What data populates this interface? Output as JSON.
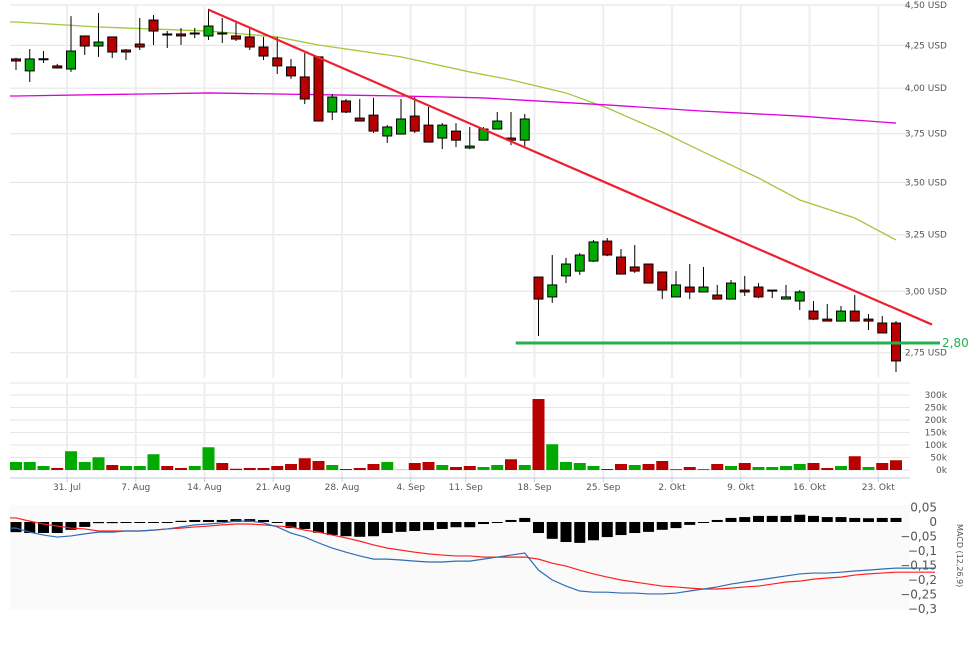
{
  "chart_data": [
    {
      "type": "candlestick",
      "panel": "price",
      "y_scale": "log",
      "ylim": [
        2.66,
        4.5
      ],
      "grid": true,
      "y_ticks": [
        {
          "value": 4.5,
          "label": "4,50 USD"
        },
        {
          "value": 4.25,
          "label": "4,25 USD"
        },
        {
          "value": 4.0,
          "label": "4,00 USD"
        },
        {
          "value": 3.75,
          "label": "3,75 USD"
        },
        {
          "value": 3.5,
          "label": "3,50 USD"
        },
        {
          "value": 3.25,
          "label": "3,25 USD"
        },
        {
          "value": 3.0,
          "label": "3,00 USD"
        },
        {
          "value": 2.75,
          "label": "2,75 USD"
        }
      ],
      "colors": {
        "up": "#00aa00",
        "down": "#b80000",
        "ma_long": "#dd00dd",
        "ma_short": "#a2c83c",
        "trendline": "#ee2030",
        "support": "#22b14c"
      },
      "dates": [
        "25. Jul",
        "26. Jul",
        "27. Jul",
        "28. Jul",
        "31. Jul",
        "1. Aug",
        "2. Aug",
        "3. Aug",
        "4. Aug",
        "7. Aug",
        "8. Aug",
        "9. Aug",
        "10. Aug",
        "11. Aug",
        "14. Aug",
        "15. Aug",
        "16. Aug",
        "17. Aug",
        "18. Aug",
        "21. Aug",
        "22. Aug",
        "23. Aug",
        "24. Aug",
        "25. Aug",
        "28. Aug",
        "29. Aug",
        "30. Aug",
        "31. Aug",
        "1. Sep",
        "5. Sep",
        "6. Sep",
        "7. Sep",
        "8. Sep",
        "11. Sep",
        "12. Sep",
        "13. Sep",
        "14. Sep",
        "15. Sep",
        "18. Sep",
        "19. Sep",
        "20. Sep",
        "21. Sep",
        "22. Sep",
        "25. Sep",
        "26. Sep",
        "27. Sep",
        "28. Sep",
        "29. Sep",
        "2. Okt",
        "3. Okt",
        "4. Okt",
        "5. Okt",
        "6. Okt",
        "9. Okt",
        "10. Okt",
        "11. Okt",
        "12. Okt",
        "13. Okt",
        "16. Okt",
        "17. Okt",
        "18. Okt",
        "19. Okt",
        "20. Okt",
        "23. Okt",
        "24. Okt"
      ],
      "ohlc": [
        [
          4.169,
          4.175,
          4.104,
          4.157
        ],
        [
          4.099,
          4.228,
          4.035,
          4.169
        ],
        [
          4.17,
          4.216,
          4.145,
          4.17
        ],
        [
          4.128,
          4.14,
          4.116,
          4.116
        ],
        [
          4.11,
          4.43,
          4.093,
          4.216
        ],
        [
          4.307,
          4.307,
          4.192,
          4.246
        ],
        [
          4.246,
          4.449,
          4.181,
          4.27
        ],
        [
          4.301,
          4.301,
          4.175,
          4.21
        ],
        [
          4.222,
          4.228,
          4.163,
          4.21
        ],
        [
          4.258,
          4.418,
          4.222,
          4.24
        ],
        [
          4.405,
          4.437,
          4.252,
          4.337
        ],
        [
          4.319,
          4.337,
          4.234,
          4.319
        ],
        [
          4.319,
          4.356,
          4.252,
          4.307
        ],
        [
          4.325,
          4.356,
          4.294,
          4.325
        ],
        [
          4.307,
          4.475,
          4.282,
          4.368
        ],
        [
          4.325,
          4.418,
          4.264,
          4.319
        ],
        [
          4.307,
          4.393,
          4.276,
          4.288
        ],
        [
          4.301,
          4.356,
          4.222,
          4.24
        ],
        [
          4.24,
          4.301,
          4.163,
          4.186
        ],
        [
          4.175,
          4.301,
          4.081,
          4.128
        ],
        [
          4.122,
          4.169,
          4.052,
          4.07
        ],
        [
          4.064,
          4.204,
          3.911,
          3.939
        ],
        [
          4.181,
          4.186,
          3.818,
          3.818
        ],
        [
          3.867,
          3.967,
          3.823,
          3.95
        ],
        [
          3.928,
          3.939,
          3.861,
          3.867
        ],
        [
          3.834,
          3.939,
          3.818,
          3.818
        ],
        [
          3.85,
          3.945,
          3.754,
          3.764
        ],
        [
          3.738,
          3.796,
          3.701,
          3.786
        ],
        [
          3.748,
          3.939,
          3.748,
          3.829
        ],
        [
          3.845,
          3.95,
          3.754,
          3.764
        ],
        [
          3.796,
          3.895,
          3.706,
          3.706
        ],
        [
          3.727,
          3.807,
          3.669,
          3.796
        ],
        [
          3.764,
          3.807,
          3.68,
          3.716
        ],
        [
          3.675,
          3.786,
          3.669,
          3.685
        ],
        [
          3.716,
          3.786,
          3.716,
          3.775
        ],
        [
          3.775,
          3.867,
          3.775,
          3.818
        ],
        [
          3.727,
          3.867,
          3.69,
          3.716
        ],
        [
          3.716,
          3.856,
          3.685,
          3.829
        ],
        [
          3.061,
          3.061,
          2.816,
          2.967
        ],
        [
          2.976,
          3.158,
          2.951,
          3.027
        ],
        [
          3.066,
          3.145,
          3.035,
          3.118
        ],
        [
          3.087,
          3.167,
          3.07,
          3.158
        ],
        [
          3.131,
          3.226,
          3.127,
          3.217
        ],
        [
          3.221,
          3.235,
          3.153,
          3.158
        ],
        [
          3.149,
          3.185,
          3.074,
          3.074
        ],
        [
          3.105,
          3.203,
          3.079,
          3.087
        ],
        [
          3.118,
          3.118,
          3.035,
          3.035
        ],
        [
          3.083,
          3.083,
          2.967,
          3.005
        ],
        [
          2.976,
          3.087,
          2.976,
          3.027
        ],
        [
          3.018,
          3.118,
          2.967,
          2.997
        ],
        [
          2.997,
          3.105,
          2.997,
          3.018
        ],
        [
          2.984,
          3.027,
          2.967,
          2.967
        ],
        [
          2.967,
          3.048,
          2.967,
          3.035
        ],
        [
          3.005,
          3.066,
          2.98,
          2.997
        ],
        [
          3.018,
          3.035,
          2.971,
          2.976
        ],
        [
          3.005,
          3.005,
          2.971,
          3.005
        ],
        [
          2.967,
          3.027,
          2.967,
          2.976
        ],
        [
          2.959,
          3.005,
          2.921,
          2.997
        ],
        [
          2.917,
          2.959,
          2.88,
          2.884
        ],
        [
          2.884,
          2.946,
          2.876,
          2.876
        ],
        [
          2.876,
          2.938,
          2.876,
          2.917
        ],
        [
          2.917,
          2.984,
          2.876,
          2.876
        ],
        [
          2.884,
          2.905,
          2.84,
          2.876
        ],
        [
          2.868,
          2.897,
          2.828,
          2.828
        ],
        [
          2.868,
          2.876,
          2.676,
          2.718
        ]
      ],
      "moving_averages": [
        {
          "color_key": "ma_short",
          "points": [
            [
              "25. Jul",
              4.393
            ],
            [
              "2. Aug",
              4.362
            ],
            [
              "14. Aug",
              4.337
            ],
            [
              "21. Aug",
              4.301
            ],
            [
              "24. Aug",
              4.252
            ],
            [
              "1. Sep",
              4.181
            ],
            [
              "11. Sep",
              4.093
            ],
            [
              "14. Sep",
              4.047
            ],
            [
              "20. Sep",
              3.973
            ],
            [
              "25. Sep",
              3.889
            ],
            [
              "29. Sep",
              3.759
            ],
            [
              "4. Okt",
              3.654
            ],
            [
              "10. Okt",
              3.522
            ],
            [
              "13. Okt",
              3.414
            ],
            [
              "19. Okt",
              3.328
            ],
            [
              "24. Okt",
              3.226
            ]
          ]
        },
        {
          "color_key": "ma_long",
          "points": [
            [
              "25. Jul",
              3.956
            ],
            [
              "14. Aug",
              3.973
            ],
            [
              "1. Sep",
              3.956
            ],
            [
              "12. Sep",
              3.945
            ],
            [
              "25. Sep",
              3.906
            ],
            [
              "4. Okt",
              3.872
            ],
            [
              "13. Okt",
              3.845
            ],
            [
              "24. Okt",
              3.807
            ]
          ]
        }
      ],
      "trendline": {
        "from": [
          "14. Aug",
          4.47
        ],
        "to": [
          "24. Okt",
          2.926
        ]
      },
      "support": {
        "value": 2.8,
        "from": "15. Sep",
        "label": "2,80"
      }
    },
    {
      "type": "bar",
      "panel": "volume",
      "ylim": [
        0,
        300000
      ],
      "y_ticks": [
        {
          "value": 300000,
          "label": "300k"
        },
        {
          "value": 250000,
          "label": "250k"
        },
        {
          "value": 200000,
          "label": "200k"
        },
        {
          "value": 150000,
          "label": "150k"
        },
        {
          "value": 100000,
          "label": "100k"
        },
        {
          "value": 50000,
          "label": "50k"
        },
        {
          "value": 0,
          "label": "0k"
        }
      ],
      "values_k": [
        32,
        32,
        16,
        8,
        75,
        32,
        51,
        20,
        16,
        16,
        63,
        16,
        8,
        16,
        91,
        28,
        5,
        8,
        8,
        16,
        24,
        47,
        36,
        20,
        4,
        8,
        24,
        32,
        1,
        28,
        32,
        20,
        12,
        16,
        12,
        20,
        43,
        20,
        284,
        103,
        32,
        28,
        16,
        4,
        24,
        20,
        24,
        36,
        4,
        12,
        4,
        24,
        16,
        28,
        12,
        12,
        16,
        24,
        28,
        8,
        16,
        55,
        12,
        28,
        39
      ],
      "direction": [
        "up",
        "up",
        "up",
        "down",
        "up",
        "up",
        "up",
        "down",
        "up",
        "up",
        "up",
        "down",
        "down",
        "up",
        "up",
        "down",
        "down",
        "down",
        "down",
        "down",
        "down",
        "down",
        "down",
        "up",
        "down",
        "down",
        "down",
        "up",
        "up",
        "down",
        "down",
        "up",
        "down",
        "down",
        "up",
        "up",
        "down",
        "up",
        "down",
        "up",
        "up",
        "up",
        "up",
        "down",
        "down",
        "up",
        "down",
        "down",
        "up",
        "down",
        "up",
        "down",
        "up",
        "down",
        "up",
        "up",
        "up",
        "up",
        "down",
        "down",
        "up",
        "down",
        "up",
        "down",
        "down"
      ],
      "x_ticks": [
        "31. Jul",
        "7. Aug",
        "14. Aug",
        "21. Aug",
        "28. Aug",
        "4. Sep",
        "11. Sep",
        "18. Sep",
        "25. Sep",
        "2. Okt",
        "9. Okt",
        "16. Okt",
        "23. Okt"
      ]
    },
    {
      "type": "line",
      "panel": "macd",
      "title": "MACD (12,26,9)",
      "ylim": [
        -0.3,
        0.05
      ],
      "y_ticks": [
        {
          "value": 0.05,
          "label": "0,05"
        },
        {
          "value": 0,
          "label": "0"
        },
        {
          "value": -0.05,
          "label": "−0,05"
        },
        {
          "value": -0.1,
          "label": "−0,1"
        },
        {
          "value": -0.15,
          "label": "−0,15"
        },
        {
          "value": -0.2,
          "label": "−0,2"
        },
        {
          "value": -0.25,
          "label": "−0,25"
        },
        {
          "value": -0.3,
          "label": "−0,3"
        }
      ],
      "colors": {
        "macd": "#2f6db5",
        "signal": "#ff2020",
        "histogram": "#000000"
      },
      "macd": [
        -0.021,
        -0.035,
        -0.045,
        -0.052,
        -0.048,
        -0.041,
        -0.035,
        -0.035,
        -0.031,
        -0.031,
        -0.028,
        -0.024,
        -0.017,
        -0.01,
        -0.007,
        -0.003,
        0.003,
        0.003,
        -0.003,
        -0.017,
        -0.038,
        -0.052,
        -0.072,
        -0.09,
        -0.104,
        -0.117,
        -0.128,
        -0.128,
        -0.131,
        -0.135,
        -0.138,
        -0.138,
        -0.135,
        -0.135,
        -0.128,
        -0.121,
        -0.114,
        -0.107,
        -0.166,
        -0.2,
        -0.221,
        -0.238,
        -0.242,
        -0.242,
        -0.245,
        -0.245,
        -0.248,
        -0.248,
        -0.245,
        -0.238,
        -0.231,
        -0.224,
        -0.214,
        -0.207,
        -0.2,
        -0.193,
        -0.186,
        -0.179,
        -0.176,
        -0.176,
        -0.173,
        -0.169,
        -0.166,
        -0.162,
        -0.159
      ],
      "signal": [
        0.014,
        0.003,
        -0.007,
        -0.014,
        -0.021,
        -0.024,
        -0.031,
        -0.031,
        -0.031,
        -0.031,
        -0.028,
        -0.024,
        -0.021,
        -0.017,
        -0.014,
        -0.01,
        -0.007,
        -0.007,
        -0.01,
        -0.014,
        -0.017,
        -0.028,
        -0.035,
        -0.045,
        -0.055,
        -0.066,
        -0.079,
        -0.09,
        -0.097,
        -0.104,
        -0.11,
        -0.114,
        -0.117,
        -0.117,
        -0.121,
        -0.121,
        -0.121,
        -0.121,
        -0.128,
        -0.142,
        -0.152,
        -0.166,
        -0.179,
        -0.19,
        -0.2,
        -0.207,
        -0.214,
        -0.221,
        -0.224,
        -0.228,
        -0.231,
        -0.231,
        -0.228,
        -0.224,
        -0.221,
        -0.214,
        -0.207,
        -0.204,
        -0.197,
        -0.193,
        -0.19,
        -0.183,
        -0.179,
        -0.176,
        -0.173
      ]
    }
  ]
}
